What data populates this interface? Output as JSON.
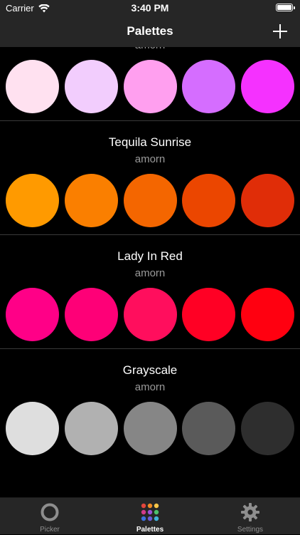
{
  "status_bar": {
    "carrier": "Carrier",
    "time": "3:40 PM",
    "wifi_icon": "wifi-icon",
    "battery_icon": "battery-icon"
  },
  "nav": {
    "title": "Palettes",
    "add_icon": "plus-icon"
  },
  "palettes": [
    {
      "name": "",
      "author": "amorn",
      "colors": [
        "#FFE1F0",
        "#F2CDFD",
        "#FF9FEF",
        "#D56DFF",
        "#F531FF"
      ]
    },
    {
      "name": "Tequila Sunrise",
      "author": "amorn",
      "colors": [
        "#FF9A00",
        "#FA7F00",
        "#F46600",
        "#EB4600",
        "#E02D08"
      ]
    },
    {
      "name": "Lady In Red",
      "author": "amorn",
      "colors": [
        "#FF0087",
        "#FE0077",
        "#FF0E5D",
        "#FF0024",
        "#FF0010"
      ]
    },
    {
      "name": "Grayscale",
      "author": "amorn",
      "colors": [
        "#DEDEDE",
        "#B1B1B1",
        "#868686",
        "#5A5A5A",
        "#2E2E2E"
      ]
    }
  ],
  "tabs": [
    {
      "label": "Picker",
      "icon": "ring-icon",
      "active": false
    },
    {
      "label": "Palettes",
      "icon": "color-dots-icon",
      "active": true
    },
    {
      "label": "Settings",
      "icon": "gear-icon",
      "active": false
    }
  ]
}
